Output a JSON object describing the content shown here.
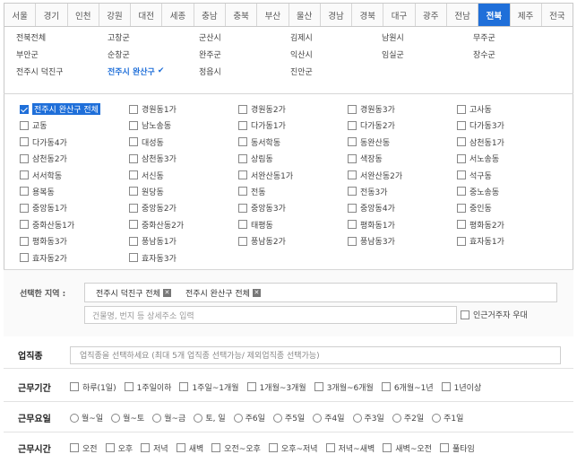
{
  "tabs": [
    "서울",
    "경기",
    "인천",
    "강원",
    "대전",
    "세종",
    "충남",
    "충북",
    "부산",
    "울산",
    "경남",
    "경북",
    "대구",
    "광주",
    "전남",
    "전북",
    "제주",
    "전국"
  ],
  "active_tab": "전북",
  "districts": [
    "전북전체",
    "고창군",
    "군산시",
    "김제시",
    "남원시",
    "무주군",
    "부안군",
    "순창군",
    "완주군",
    "익산시",
    "임실군",
    "장수군",
    "전주시 덕진구",
    "전주시 완산구",
    "정읍시",
    "진안군"
  ],
  "selected_district": "전주시 완산구",
  "dongs": [
    "전주시 완산구 전체",
    "경원동1가",
    "경원동2가",
    "경원동3가",
    "고사동",
    "교동",
    "남노송동",
    "다가동1가",
    "다가동2가",
    "다가동3가",
    "다가동4가",
    "대성동",
    "동서학동",
    "동완산동",
    "삼천동1가",
    "삼천동2가",
    "삼천동3가",
    "상림동",
    "색장동",
    "서노송동",
    "서서학동",
    "서신동",
    "서완산동1가",
    "서완산동2가",
    "석구동",
    "용복동",
    "원당동",
    "전동",
    "전동3가",
    "중노송동",
    "중앙동1가",
    "중앙동2가",
    "중앙동3가",
    "중앙동4가",
    "중인동",
    "중화산동1가",
    "중화산동2가",
    "태평동",
    "평화동1가",
    "평화동2가",
    "평화동3가",
    "풍남동1가",
    "풍남동2가",
    "풍남동3가",
    "효자동1가",
    "효자동2가",
    "효자동3가"
  ],
  "checked_dong": "전주시 완산구 전체",
  "selected_region": {
    "label": "선택한 지역 :",
    "chips": [
      "전주시 덕진구 전체",
      "전주시 완산구 전체"
    ],
    "address_placeholder": "건물명, 번지 등 상세주소 입력",
    "nearby_label": "인근거주자 우대"
  },
  "job": {
    "label": "업직종",
    "placeholder": "업직종을 선택하세요 (최대 5개 업직종 선택가능/ 제외업직종 선택가능)"
  },
  "period": {
    "label": "근무기간",
    "options": [
      "하루(1일)",
      "1주일이하",
      "1주일~1개월",
      "1개월~3개월",
      "3개월~6개월",
      "6개월~1년",
      "1년이상"
    ]
  },
  "days": {
    "label": "근무요일",
    "options": [
      "월~일",
      "월~토",
      "월~금",
      "토, 일",
      "주6일",
      "주5일",
      "주4일",
      "주3일",
      "주2일",
      "주1일"
    ]
  },
  "time": {
    "label": "근무시간",
    "options": [
      "오전",
      "오후",
      "저녁",
      "새벽",
      "오전~오후",
      "오후~저녁",
      "저녁~새벽",
      "새벽~오전",
      "풀타임"
    ]
  },
  "colors": {
    "accent": "#1f6fd9"
  }
}
